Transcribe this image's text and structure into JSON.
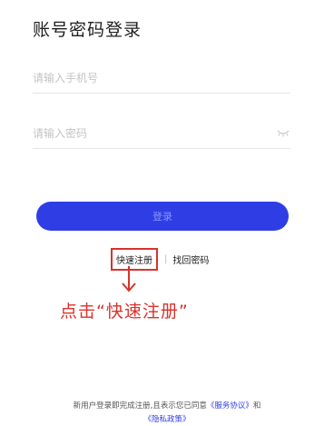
{
  "title": "账号密码登录",
  "phone_input": {
    "placeholder": "请输入手机号",
    "value": ""
  },
  "password_input": {
    "placeholder": "请输入密码",
    "value": ""
  },
  "login_button": {
    "label": "登录"
  },
  "links": {
    "quick_register": "快速注册",
    "separator": "|",
    "find_password": "找回密码"
  },
  "annotation": "点击“快速注册”",
  "agreement": {
    "prefix": "新用户登录即完成注册,且表示您已同意",
    "service": "《服务协议》",
    "and": "和",
    "privacy": "《隐私政策》"
  },
  "colors": {
    "primary_button": "#2e3ee4",
    "annotation_red": "#d8322c",
    "link_blue": "#2e3ee4"
  },
  "icons": {
    "password_toggle": "eye-closed-icon",
    "annotation_arrow": "arrow-down-icon"
  }
}
